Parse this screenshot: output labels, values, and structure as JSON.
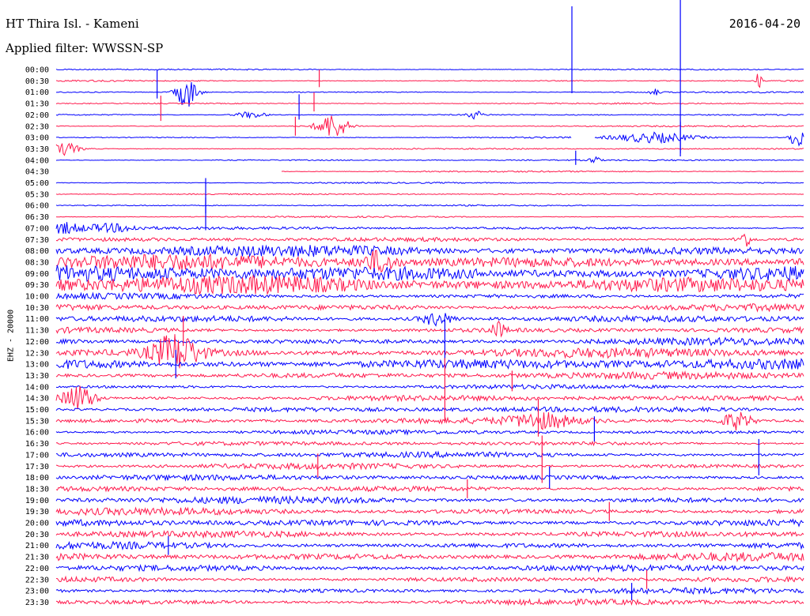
{
  "header": {
    "station": "HT Thira Isl. - Kameni",
    "filter": "Applied filter: WWSSN-SP",
    "date": "2016-04-20"
  },
  "chart_data": {
    "type": "line",
    "title": "HT Thira Isl. - Kameni",
    "ylabel": "EHZ - 20000",
    "xlabel": "",
    "categories": [
      "00:00",
      "00:30",
      "01:00",
      "01:30",
      "02:00",
      "02:30",
      "03:00",
      "03:30",
      "04:00",
      "04:30",
      "05:00",
      "05:30",
      "06:00",
      "06:30",
      "07:00",
      "07:30",
      "08:00",
      "08:30",
      "09:00",
      "09:30",
      "10:00",
      "10:30",
      "11:00",
      "11:30",
      "12:00",
      "12:30",
      "13:00",
      "13:30",
      "14:00",
      "14:30",
      "15:00",
      "15:30",
      "16:00",
      "16:30",
      "17:00",
      "17:30",
      "18:00",
      "18:30",
      "19:00",
      "19:30",
      "20:00",
      "20:30",
      "21:00",
      "21:30",
      "22:00",
      "22:30",
      "23:00",
      "23:30"
    ],
    "series_colors": [
      "#0000ff",
      "#ff1a4d"
    ],
    "noise_level": [
      1,
      1,
      1,
      1,
      1,
      1,
      1,
      1,
      1,
      1,
      1,
      1,
      1,
      1,
      2,
      3,
      8,
      11,
      12,
      14,
      4,
      5,
      5,
      4,
      5,
      7,
      8,
      5,
      3,
      4,
      4,
      4,
      3,
      3,
      4,
      4,
      4,
      4,
      5,
      5,
      5,
      5,
      5,
      6,
      5,
      4,
      4,
      4
    ],
    "events": [
      {
        "line": 1,
        "at": 0.94,
        "amp": 12,
        "width": 0.004
      },
      {
        "line": 2,
        "at": 0.175,
        "amp": 20,
        "width": 0.014
      },
      {
        "line": 2,
        "at": 0.8,
        "amp": 5,
        "width": 0.006
      },
      {
        "line": 4,
        "at": 0.26,
        "amp": 4,
        "width": 0.02
      },
      {
        "line": 4,
        "at": 0.56,
        "amp": 5,
        "width": 0.01
      },
      {
        "line": 5,
        "at": 0.37,
        "amp": 16,
        "width": 0.02
      },
      {
        "line": 6,
        "at": 0.8,
        "amp": 6,
        "width": 0.05
      },
      {
        "line": 6,
        "at": 0.99,
        "amp": 13,
        "width": 0.01
      },
      {
        "line": 7,
        "at": 0.01,
        "amp": 8,
        "width": 0.02
      },
      {
        "line": 8,
        "at": 0.72,
        "amp": 8,
        "width": 0.005
      },
      {
        "line": 14,
        "at": 0.01,
        "amp": 7,
        "width": 0.02
      },
      {
        "line": 14,
        "at": 0.07,
        "amp": 5,
        "width": 0.04
      },
      {
        "line": 15,
        "at": 0.92,
        "amp": 10,
        "width": 0.01
      },
      {
        "line": 17,
        "at": 0.43,
        "amp": 12,
        "width": 0.02
      },
      {
        "line": 22,
        "at": 0.51,
        "amp": 8,
        "width": 0.02
      },
      {
        "line": 23,
        "at": 0.59,
        "amp": 10,
        "width": 0.01
      },
      {
        "line": 25,
        "at": 0.16,
        "amp": 22,
        "width": 0.03
      },
      {
        "line": 29,
        "at": 0.03,
        "amp": 16,
        "width": 0.02
      },
      {
        "line": 31,
        "at": 0.65,
        "amp": 8,
        "width": 0.04
      },
      {
        "line": 31,
        "at": 0.91,
        "amp": 11,
        "width": 0.02
      }
    ],
    "gaps": [
      {
        "line": 6,
        "from": 0.69,
        "to": 0.72
      },
      {
        "line": 9,
        "from": 0.0,
        "to": 0.3
      }
    ],
    "spikes": [
      {
        "line": 2,
        "at": 0.135,
        "up": 28,
        "down": 8
      },
      {
        "line": 3,
        "at": 0.14,
        "up": 10,
        "down": 22
      },
      {
        "line": 4,
        "at": 0.325,
        "up": 26,
        "down": 6
      },
      {
        "line": 3,
        "at": 0.345,
        "up": 14,
        "down": 10
      },
      {
        "line": 1,
        "at": 0.352,
        "up": 14,
        "down": 8
      },
      {
        "line": 5,
        "at": 0.32,
        "up": 12,
        "down": 12
      },
      {
        "line": 0,
        "at": 0.69,
        "up": 80,
        "down": 30
      },
      {
        "line": 8,
        "at": 0.695,
        "up": 12,
        "down": 6
      },
      {
        "line": 0,
        "at": 0.835,
        "up": 100,
        "down": 110
      },
      {
        "line": 6,
        "at": 0.835,
        "up": 20,
        "down": 20
      },
      {
        "line": 10,
        "at": 0.2,
        "up": 6,
        "down": 60
      },
      {
        "line": 12,
        "at": 0.2,
        "up": 10,
        "down": 10
      },
      {
        "line": 23,
        "at": 0.17,
        "up": 18,
        "down": 20
      },
      {
        "line": 26,
        "at": 0.16,
        "up": 18,
        "down": 18
      },
      {
        "line": 24,
        "at": 0.52,
        "up": 28,
        "down": 32
      },
      {
        "line": 27,
        "at": 0.52,
        "up": 22,
        "down": 60
      },
      {
        "line": 27,
        "at": 0.61,
        "up": 6,
        "down": 20
      },
      {
        "line": 31,
        "at": 0.645,
        "up": 28,
        "down": 20
      },
      {
        "line": 32,
        "at": 0.72,
        "up": 20,
        "down": 12
      },
      {
        "line": 33,
        "at": 0.65,
        "up": 10,
        "down": 50
      },
      {
        "line": 34,
        "at": 0.94,
        "up": 20,
        "down": 26
      },
      {
        "line": 35,
        "at": 0.35,
        "up": 16,
        "down": 14
      },
      {
        "line": 36,
        "at": 0.66,
        "up": 14,
        "down": 14
      },
      {
        "line": 37,
        "at": 0.55,
        "up": 12,
        "down": 12
      },
      {
        "line": 39,
        "at": 0.74,
        "up": 12,
        "down": 12
      },
      {
        "line": 42,
        "at": 0.15,
        "up": 12,
        "down": 12
      },
      {
        "line": 45,
        "at": 0.79,
        "up": 12,
        "down": 12
      },
      {
        "line": 46,
        "at": 0.77,
        "up": 10,
        "down": 12
      }
    ]
  }
}
